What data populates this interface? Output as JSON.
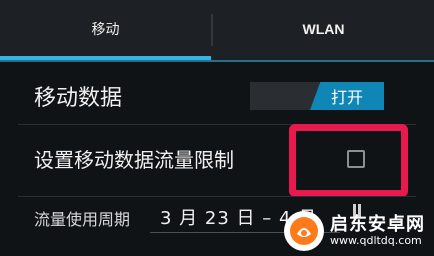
{
  "tabs": [
    {
      "label": "移动"
    },
    {
      "label": "WLAN"
    }
  ],
  "settings": {
    "mobile_data_label": "移动数据",
    "mobile_data_toggle": "打开",
    "limit_label": "设置移动数据流量限制",
    "limit_checked": false,
    "cycle_label": "流量使用周期",
    "cycle_value": "3 月 23 日 – 4 月"
  },
  "watermark": {
    "name": "启东安卓网",
    "url": "www.qdltdq.com",
    "logo": "phone-logo-icon"
  },
  "colors": {
    "accent": "#33b5e5",
    "toggle_on": "#0f86b5",
    "highlight": "#e8194f"
  }
}
